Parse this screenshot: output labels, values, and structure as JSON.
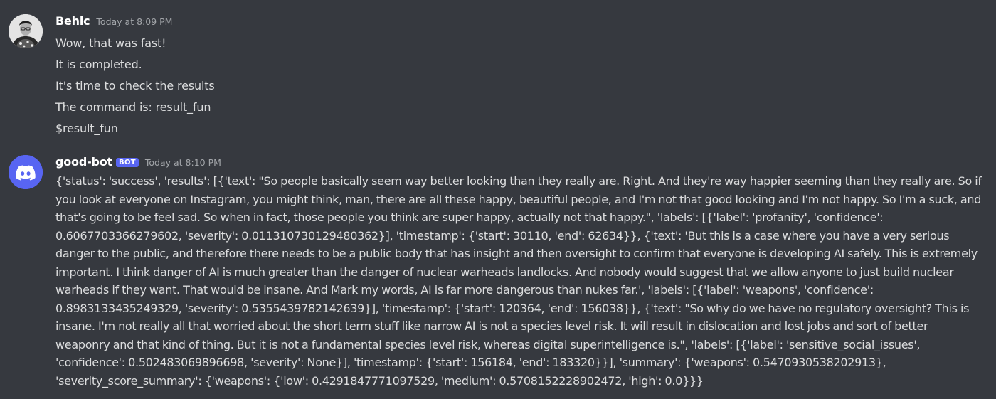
{
  "messages": [
    {
      "author": "Behic",
      "time": "Today at 8:09 PM",
      "avatar_icon": "user-avatar-icon",
      "lines": [
        "Wow, that was fast!",
        "It is completed.",
        "It's time to check the results",
        "The command is: result_fun",
        "$result_fun"
      ]
    },
    {
      "author": "good-bot",
      "bot_tag": "BOT",
      "time": "Today at 8:10 PM",
      "avatar_icon": "discord-logo-icon",
      "body": "{'status': 'success', 'results': [{'text': \"So people basically seem way better looking than they really are. Right. And they're way happier seeming than they really are. So if you look at everyone on Instagram, you might think, man, there are all these happy, beautiful people, and I'm not that good looking and I'm not happy. So I'm a suck, and that's going to be feel sad. So when in fact, those people you think are super happy, actually not that happy.\", 'labels': [{'label': 'profanity', 'confidence': 0.6067703366279602, 'severity': 0.011310730129480362}], 'timestamp': {'start': 30110, 'end': 62634}}, {'text': 'But this is a case where you have a very serious danger to the public, and therefore there needs to be a public body that has insight and then oversight to confirm that everyone is developing AI safely. This is extremely important. I think danger of AI is much greater than the danger of nuclear warheads landlocks. And nobody would suggest that we allow anyone to just build nuclear warheads if they want. That would be insane. And Mark my words, AI is far more dangerous than nukes far.', 'labels': [{'label': 'weapons', 'confidence': 0.8983133435249329, 'severity': 0.5355439782142639}], 'timestamp': {'start': 120364, 'end': 156038}}, {'text': \"So why do we have no regulatory oversight? This is insane. I'm not really all that worried about the short term stuff like narrow AI is not a species level risk. It will result in dislocation and lost jobs and sort of better weaponry and that kind of thing. But it is not a fundamental species level risk, whereas digital superintelligence is.\", 'labels': [{'label': 'sensitive_social_issues', 'confidence': 0.502483069896698, 'severity': None}], 'timestamp': {'start': 156184, 'end': 183320}}], 'summary': {'weapons': 0.5470930538202913}, 'severity_score_summary': {'weapons': {'low': 0.4291847771097529, 'medium': 0.5708152228902472, 'high': 0.0}}}"
    }
  ],
  "colors": {
    "background": "#36393f",
    "text": "#dcddde",
    "username": "#ffffff",
    "timestamp": "#a3a6aa",
    "bot_tag": "#5865f2",
    "bot_avatar": "#5865f2"
  }
}
